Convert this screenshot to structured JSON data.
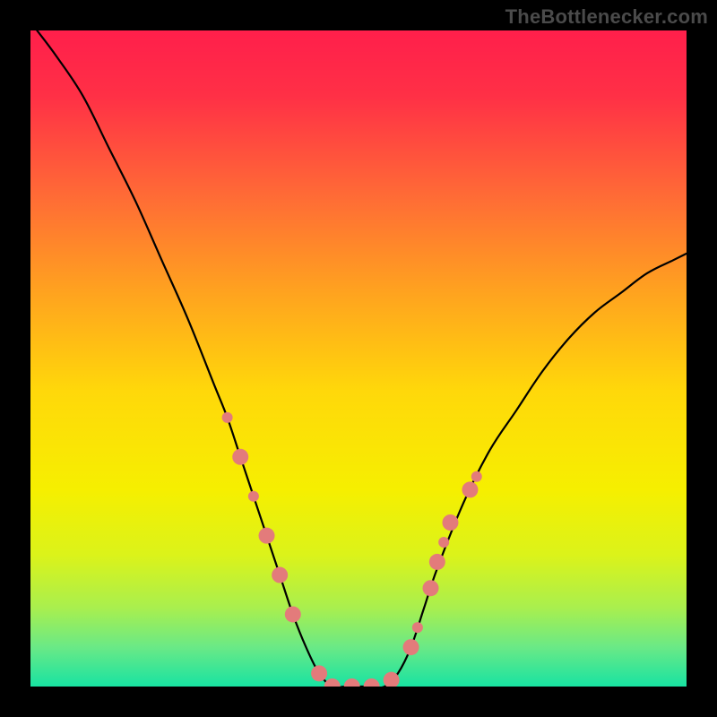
{
  "watermark": "TheBottlenecker.com",
  "chart_data": {
    "type": "line",
    "title": "",
    "xlabel": "",
    "ylabel": "",
    "xlim": [
      0,
      100
    ],
    "ylim": [
      0,
      100
    ],
    "gradient_stops": [
      {
        "offset": 0.0,
        "color": "#ff1f4b"
      },
      {
        "offset": 0.1,
        "color": "#ff3046"
      },
      {
        "offset": 0.25,
        "color": "#ff6a36"
      },
      {
        "offset": 0.4,
        "color": "#ffa31f"
      },
      {
        "offset": 0.55,
        "color": "#ffd80a"
      },
      {
        "offset": 0.7,
        "color": "#f6ef00"
      },
      {
        "offset": 0.8,
        "color": "#dbf31a"
      },
      {
        "offset": 0.88,
        "color": "#a9ef4e"
      },
      {
        "offset": 0.94,
        "color": "#6ae986"
      },
      {
        "offset": 1.0,
        "color": "#18e3a2"
      }
    ],
    "series": [
      {
        "name": "bottleneck-curve",
        "x": [
          1,
          4,
          8,
          12,
          16,
          20,
          24,
          28,
          30,
          32,
          34,
          36,
          38,
          40,
          42,
          44,
          46,
          48,
          50,
          52,
          54,
          56,
          58,
          60,
          62,
          66,
          70,
          74,
          78,
          82,
          86,
          90,
          94,
          98,
          100
        ],
        "y": [
          100,
          96,
          90,
          82,
          74,
          65,
          56,
          46,
          41,
          35,
          29,
          23,
          17,
          11,
          6,
          2,
          0,
          0,
          0,
          0,
          0,
          2,
          6,
          12,
          18,
          28,
          36,
          42,
          48,
          53,
          57,
          60,
          63,
          65,
          66
        ]
      }
    ],
    "markers": {
      "name": "highlight-points",
      "color": "#e37b7b",
      "radius_large": 9,
      "radius_small": 6,
      "points": [
        {
          "x": 30,
          "y": 41,
          "r": "small"
        },
        {
          "x": 32,
          "y": 35,
          "r": "large"
        },
        {
          "x": 34,
          "y": 29,
          "r": "small"
        },
        {
          "x": 36,
          "y": 23,
          "r": "large"
        },
        {
          "x": 38,
          "y": 17,
          "r": "large"
        },
        {
          "x": 40,
          "y": 11,
          "r": "large"
        },
        {
          "x": 44,
          "y": 2,
          "r": "large"
        },
        {
          "x": 46,
          "y": 0,
          "r": "large"
        },
        {
          "x": 49,
          "y": 0,
          "r": "large"
        },
        {
          "x": 52,
          "y": 0,
          "r": "large"
        },
        {
          "x": 55,
          "y": 1,
          "r": "large"
        },
        {
          "x": 58,
          "y": 6,
          "r": "large"
        },
        {
          "x": 59,
          "y": 9,
          "r": "small"
        },
        {
          "x": 61,
          "y": 15,
          "r": "large"
        },
        {
          "x": 62,
          "y": 19,
          "r": "large"
        },
        {
          "x": 63,
          "y": 22,
          "r": "small"
        },
        {
          "x": 64,
          "y": 25,
          "r": "large"
        },
        {
          "x": 67,
          "y": 30,
          "r": "large"
        },
        {
          "x": 68,
          "y": 32,
          "r": "small"
        }
      ]
    }
  }
}
